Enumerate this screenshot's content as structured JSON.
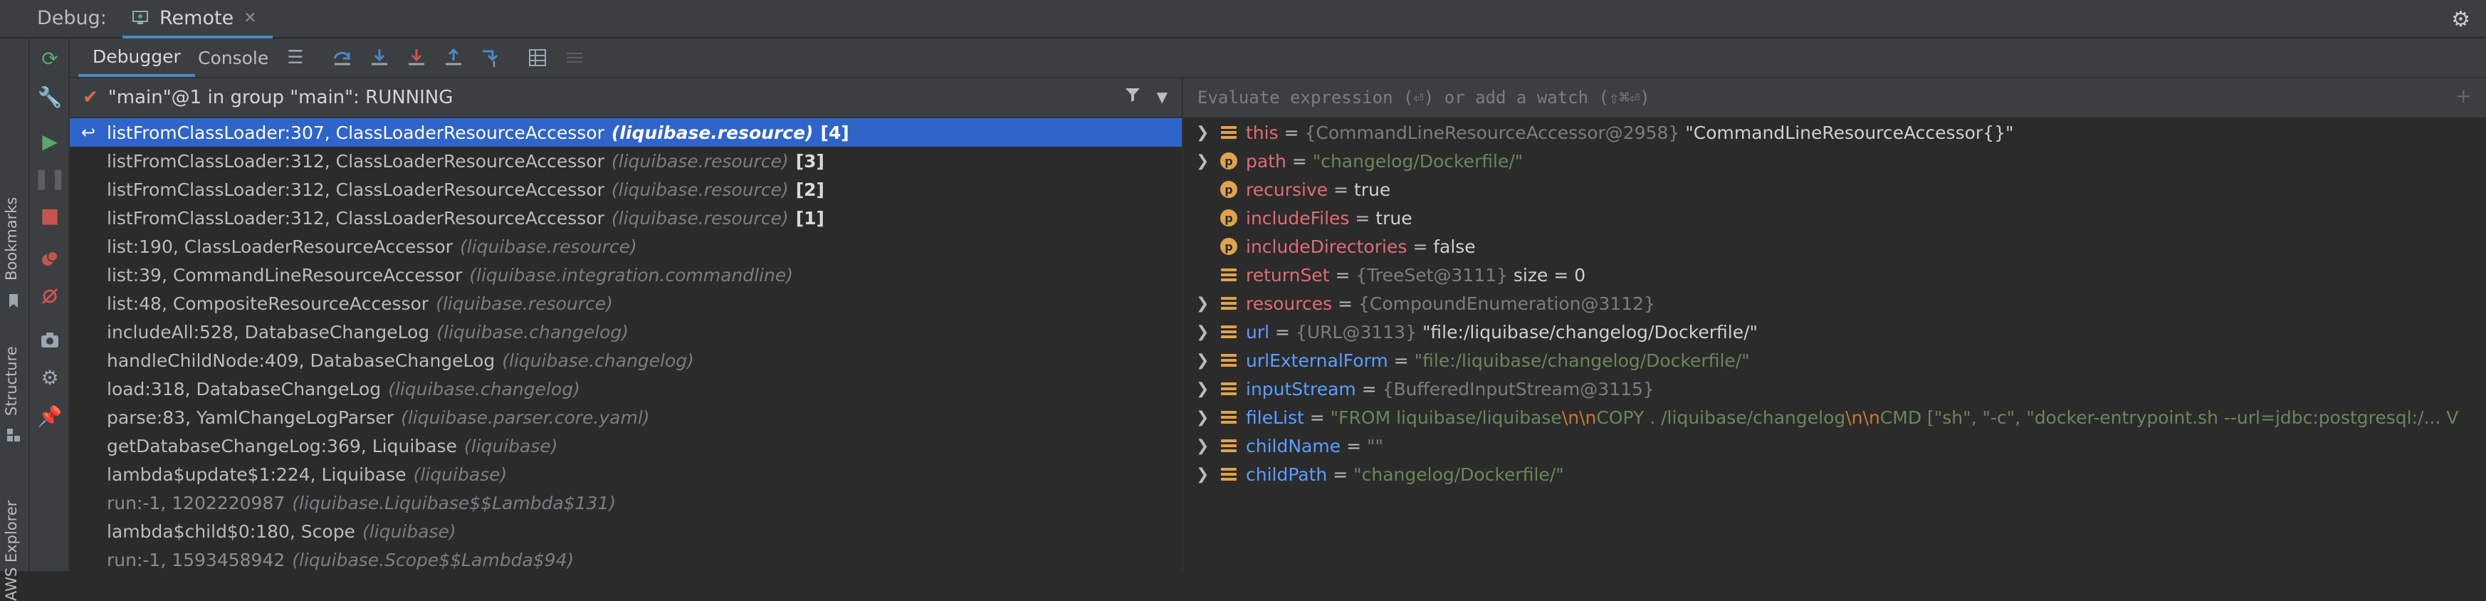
{
  "topbar": {
    "debug_label": "Debug:",
    "session_tab": "Remote"
  },
  "rail": {
    "labels": [
      "Bookmarks",
      "Structure",
      "AWS Explorer"
    ]
  },
  "subbar": {
    "tabs": [
      "Debugger",
      "Console"
    ]
  },
  "frames": {
    "thread_label": "\"main\"@1 in group \"main\": RUNNING",
    "items": [
      {
        "method": "listFromClassLoader:307, ClassLoaderResourceAccessor",
        "pkg": "(liquibase.resource)",
        "count": "[4]"
      },
      {
        "method": "listFromClassLoader:312, ClassLoaderResourceAccessor",
        "pkg": "(liquibase.resource)",
        "count": "[3]"
      },
      {
        "method": "listFromClassLoader:312, ClassLoaderResourceAccessor",
        "pkg": "(liquibase.resource)",
        "count": "[2]"
      },
      {
        "method": "listFromClassLoader:312, ClassLoaderResourceAccessor",
        "pkg": "(liquibase.resource)",
        "count": "[1]"
      },
      {
        "method": "list:190, ClassLoaderResourceAccessor",
        "pkg": "(liquibase.resource)",
        "count": ""
      },
      {
        "method": "list:39, CommandLineResourceAccessor",
        "pkg": "(liquibase.integration.commandline)",
        "count": ""
      },
      {
        "method": "list:48, CompositeResourceAccessor",
        "pkg": "(liquibase.resource)",
        "count": ""
      },
      {
        "method": "includeAll:528, DatabaseChangeLog",
        "pkg": "(liquibase.changelog)",
        "count": ""
      },
      {
        "method": "handleChildNode:409, DatabaseChangeLog",
        "pkg": "(liquibase.changelog)",
        "count": ""
      },
      {
        "method": "load:318, DatabaseChangeLog",
        "pkg": "(liquibase.changelog)",
        "count": ""
      },
      {
        "method": "parse:83, YamlChangeLogParser",
        "pkg": "(liquibase.parser.core.yaml)",
        "count": ""
      },
      {
        "method": "getDatabaseChangeLog:369, Liquibase",
        "pkg": "(liquibase)",
        "count": ""
      },
      {
        "method": "lambda$update$1:224, Liquibase",
        "pkg": "(liquibase)",
        "count": ""
      },
      {
        "method": "run:-1, 1202220987",
        "pkg": "(liquibase.Liquibase$$Lambda$131)",
        "count": ""
      },
      {
        "method": "lambda$child$0:180, Scope",
        "pkg": "(liquibase)",
        "count": ""
      },
      {
        "method": "run:-1, 1593458942",
        "pkg": "(liquibase.Scope$$Lambda$94)",
        "count": ""
      }
    ]
  },
  "variables": {
    "eval_placeholder": "Evaluate expression (⏎) or add a watch (⇧⌘⏎)",
    "items": [
      {
        "name": "this",
        "ref": "{CommandLineResourceAccessor@2958}",
        "value": "\"CommandLineResourceAccessor{}\""
      },
      {
        "name": "path",
        "value": "\"changelog/Dockerfile/\""
      },
      {
        "name": "recursive",
        "value": "true"
      },
      {
        "name": "includeFiles",
        "value": "true"
      },
      {
        "name": "includeDirectories",
        "value": "false"
      },
      {
        "name": "returnSet",
        "ref": "{TreeSet@3111}",
        "value": " size = 0"
      },
      {
        "name": "resources",
        "ref": "{CompoundEnumeration@3112}",
        "value": ""
      },
      {
        "name": "url",
        "ref": "{URL@3113}",
        "value": "\"file:/liquibase/changelog/Dockerfile/\""
      },
      {
        "name": "urlExternalForm",
        "value": "\"file:/liquibase/changelog/Dockerfile/\""
      },
      {
        "name": "inputStream",
        "ref": "{BufferedInputStream@3115}",
        "value": ""
      },
      {
        "name": "fileList",
        "v1": "\"FROM liquibase/liquibase",
        "esc1": "\\n\\n",
        "v2": "COPY . /liquibase/changelog",
        "esc2": "\\n\\n",
        "v3": "CMD [\"sh\", \"-c\", \"docker-entrypoint.sh --url=jdbc:postgresql:/... V"
      },
      {
        "name": "childName",
        "value": "\"\""
      },
      {
        "name": "childPath",
        "value": "\"changelog/Dockerfile/\""
      }
    ]
  }
}
